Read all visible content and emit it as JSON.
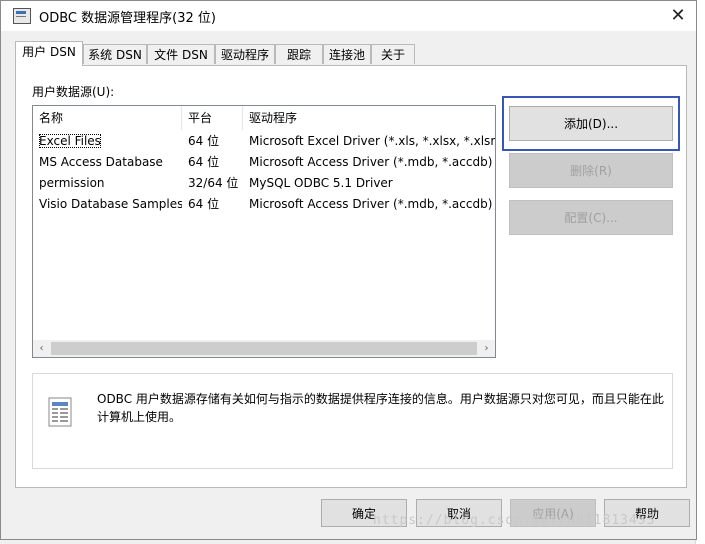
{
  "window": {
    "title": "ODBC 数据源管理程序(32 位)",
    "close_glyph": "✕"
  },
  "tabs": [
    {
      "label": "用户 DSN",
      "active": true
    },
    {
      "label": "系统 DSN"
    },
    {
      "label": "文件 DSN"
    },
    {
      "label": "驱动程序"
    },
    {
      "label": "跟踪"
    },
    {
      "label": "连接池"
    },
    {
      "label": "关于"
    }
  ],
  "section_label": "用户数据源(U):",
  "list": {
    "columns": [
      "名称",
      "平台",
      "驱动程序"
    ],
    "rows": [
      {
        "name": "Excel Files",
        "platform": "64 位",
        "driver": "Microsoft Excel Driver (*.xls, *.xlsx, *.xlsm, *"
      },
      {
        "name": "MS Access Database",
        "platform": "64 位",
        "driver": "Microsoft Access Driver (*.mdb, *.accdb)"
      },
      {
        "name": "permission",
        "platform": "32/64 位",
        "driver": "MySQL ODBC 5.1 Driver"
      },
      {
        "name": "Visio Database Samples",
        "platform": "64 位",
        "driver": "Microsoft Access Driver (*.mdb, *.accdb)"
      }
    ],
    "scroll_left": "‹",
    "scroll_right": "›"
  },
  "buttons": {
    "add": "添加(D)...",
    "remove": "删除(R)",
    "configure": "配置(C)..."
  },
  "info": {
    "icon": "document-icon",
    "text": "ODBC 用户数据源存储有关如何与指示的数据提供程序连接的信息。用户数据源只对您可见，而且只能在此计算机上使用。"
  },
  "footer": {
    "ok": "确定",
    "cancel": "取消",
    "apply": "应用(A)",
    "help": "帮助"
  },
  "watermark": "https://blog.csdn.net/u011813453",
  "colors": {
    "highlight": "#3a55b8",
    "accent": "#3c6fb6"
  }
}
